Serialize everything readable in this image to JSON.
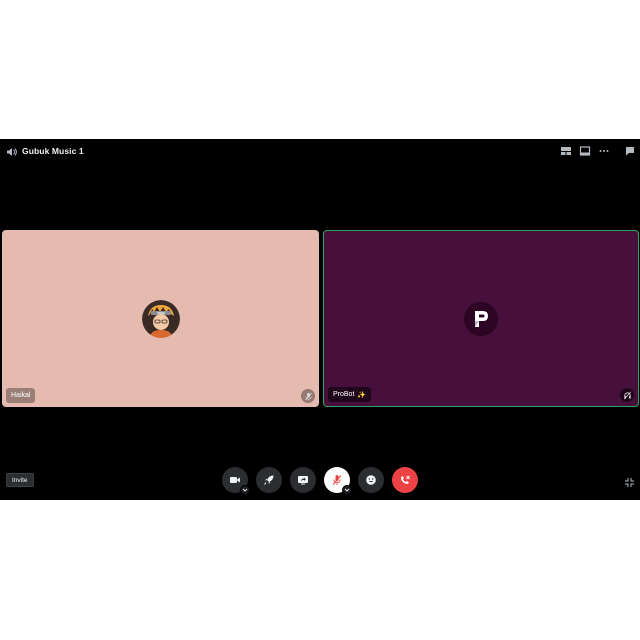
{
  "header": {
    "channel_name": "Gubuk Music 1",
    "channel_icon": "speaker-icon",
    "actions": [
      "grid-layout-icon",
      "popout-icon",
      "more-icon",
      "chat-icon"
    ]
  },
  "participants": [
    {
      "name": "Haikal",
      "avatar": "user-avatar",
      "tile_color": "#e5bbb0",
      "muted": true,
      "speaking": false
    },
    {
      "name": "ProBot",
      "badge": "✨",
      "avatar": "probot-logo",
      "tile_color": "#470f3c",
      "muted": false,
      "speaking": true
    }
  ],
  "invite_label": "Invite",
  "controls": [
    "camera",
    "activities",
    "screen-share",
    "microphone",
    "soundboard",
    "disconnect"
  ],
  "colors": {
    "accent_disconnect": "#ed4245",
    "speaking_border": "#2ea55f",
    "control_bg": "#2b2d31"
  }
}
